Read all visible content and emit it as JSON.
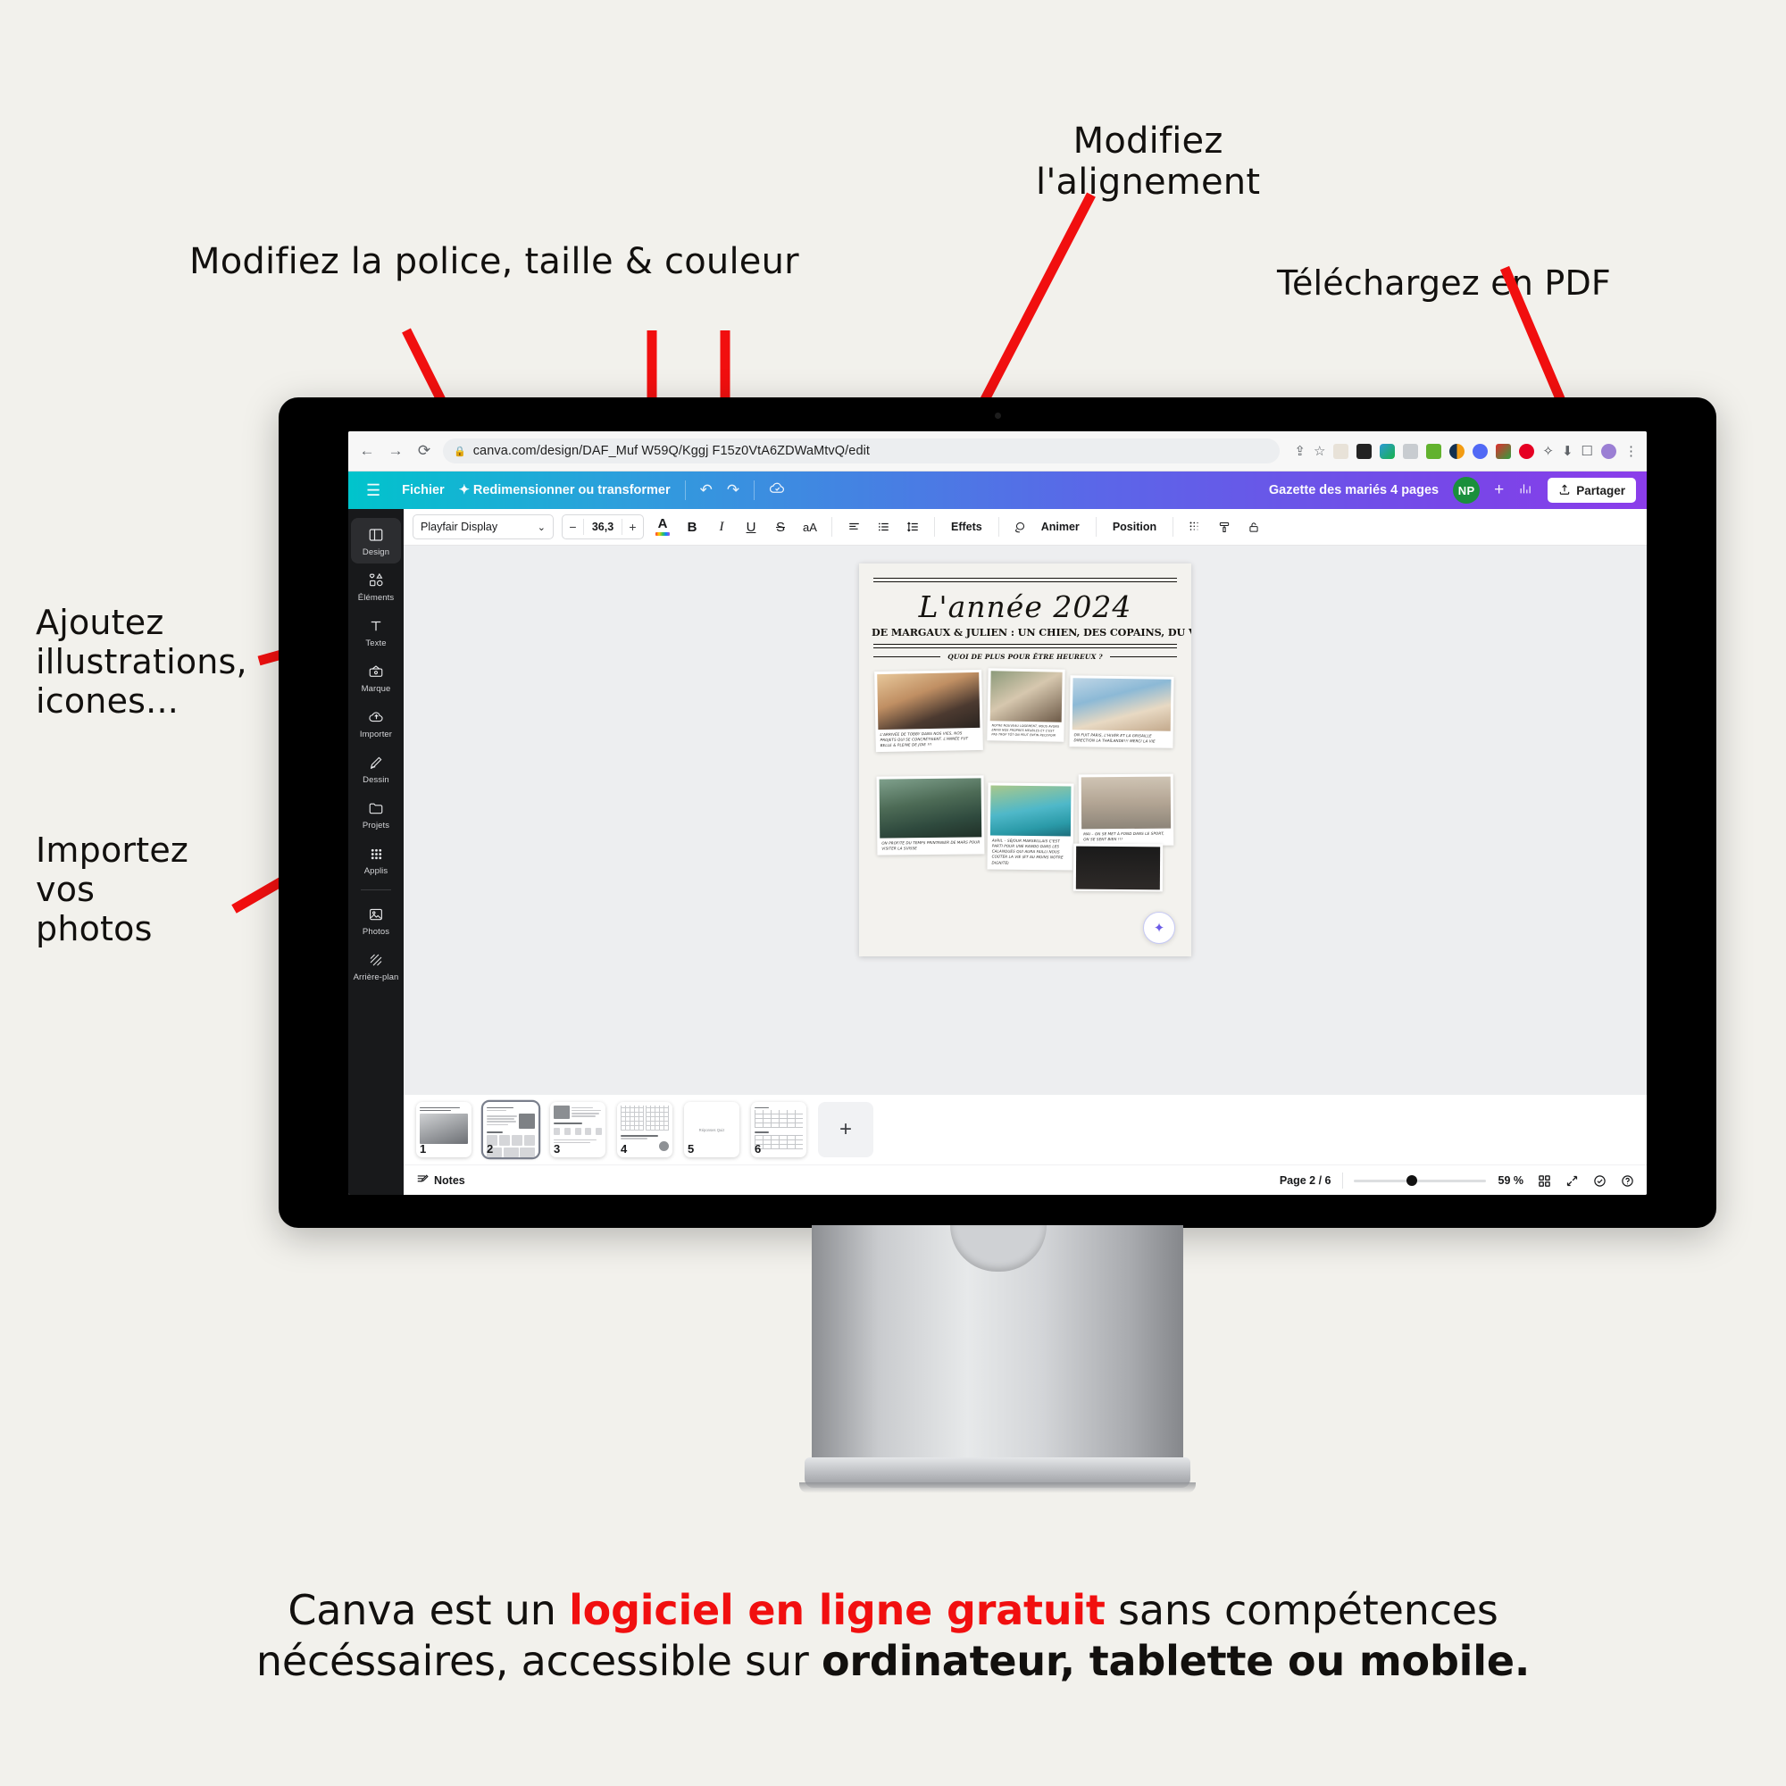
{
  "callouts": {
    "font": "Modifiez la police, taille & couleur",
    "align": "Modifiez\nl'alignement",
    "pdf": "Téléchargez en PDF",
    "elements": "Ajoutez\nillustrations,\nicones...",
    "upload": "Importez\nvos\nphotos"
  },
  "browser": {
    "back_icon": "←",
    "forward_icon": "→",
    "reload_icon": "⟳",
    "lock_icon": "🔒",
    "url": "canva.com/design/DAF_Muf W59Q/Kggj F15z0VtA6ZDWaMtvQ/edit",
    "share_icon": "share-icon",
    "bookmark_icon": "☆",
    "menu_icon": "⋮",
    "extensions": [
      "eyedropper",
      "fx",
      "translate",
      "screenshot",
      "grammar",
      "moon",
      "settings",
      "eco",
      "pinterest",
      "puzzle",
      "download",
      "sidepanel",
      "profile"
    ]
  },
  "canva_top": {
    "menu_icon": "☰",
    "file_label": "Fichier",
    "resize_label": "Redimensionner ou transformer",
    "resize_icon": "✦",
    "undo_icon": "↶",
    "redo_icon": "↷",
    "cloud_icon": "cloud-saved-icon",
    "design_title": "Gazette des mariés 4 pages",
    "avatar_initials": "NP",
    "add_member_icon": "+",
    "insights_icon": "insights-icon",
    "share_label": "Partager",
    "share_icon": "upload-icon"
  },
  "sidebar": {
    "items": [
      {
        "label": "Design",
        "icon": "layout-icon",
        "active": true
      },
      {
        "label": "Éléments",
        "icon": "shapes-icon",
        "active": false
      },
      {
        "label": "Texte",
        "icon": "text-icon",
        "active": false
      },
      {
        "label": "Marque",
        "icon": "brand-icon",
        "active": false
      },
      {
        "label": "Importer",
        "icon": "upload-cloud-icon",
        "active": false
      },
      {
        "label": "Dessin",
        "icon": "pencil-icon",
        "active": false
      },
      {
        "label": "Projets",
        "icon": "folder-icon",
        "active": false
      },
      {
        "label": "Applis",
        "icon": "grid-apps-icon",
        "active": false
      },
      {
        "label": "Photos",
        "icon": "photo-icon",
        "active": false
      },
      {
        "label": "Arrière-plan",
        "icon": "hatch-icon",
        "active": false
      }
    ]
  },
  "toolbar": {
    "font_name": "Playfair Display",
    "font_caret": "⌄",
    "minus": "−",
    "font_size": "36,3",
    "plus": "+",
    "color_letter": "A",
    "bold": "B",
    "italic": "I",
    "underline": "U",
    "strike": "S",
    "case": "aA",
    "align_icon": "align-left-icon",
    "list_icon": "list-icon",
    "spacing_icon": "line-spacing-icon",
    "effects_label": "Effets",
    "animate_label": "Animer",
    "animate_icon": "animate-icon",
    "position_label": "Position",
    "transparency_icon": "transparency-icon",
    "copy_style_icon": "paint-roller-icon",
    "lock_icon": "lock-icon"
  },
  "document": {
    "masthead": "L'année 2024",
    "subhead": "DE MARGAUX & JULIEN : UN CHIEN, DES COPAINS, DU VIN",
    "kicker": "QUOI DE PLUS POUR ÊTRE HEUREUX ?",
    "captions": [
      "L'ARRIVÉE DE TOBBY DANS NOS VIES, NOS PROJETS QUI SE CONCRÉTISENT. L'ANNÉE FUT BELLE & PLEINE DE JOIE !!!",
      "NOTRE NOUVEAU LOGEMENT, NOUS AVONS ENFIN NOS PROPRES MEUBLES ET C'EST PAS TROP TÔT ON PEUT ENFIN RECEVOIR",
      "ON FUIT PARIS, L'HIVER ET LA GRISAILLE DIRECTION LA THAÏLANDE!!! MERCI LA VIE",
      "ON PROFITE DU TEMPS PRINTANIER DE MARS POUR VISITER LA SUISSE",
      "AVRIL – SÉJOUR MARSEILLAIS C'EST PARTI POUR UNE RANDO DANS LES CALANQUES QUI AURA FAILLI NOUS COÛTER LA VIE (ET AU MOINS NOTRE DIGNITÉ)",
      "MAI – ON SE MET À FOND DANS LE SPORT, ON SE SENT BIEN !!!"
    ],
    "rotate_icon": "rotate-icon",
    "magic_icon": "magic-assistant-icon"
  },
  "pages_strip": {
    "numbers": [
      "1",
      "2",
      "3",
      "4",
      "5",
      "6"
    ],
    "selected": "2",
    "add_label": "+",
    "page5_text": "Réponses Quiz"
  },
  "statusbar": {
    "notes_label": "Notes",
    "notes_icon": "notes-icon",
    "page_indicator": "Page 2 / 6",
    "zoom_value": "59 %",
    "grid_icon": "grid-view-icon",
    "fullscreen_icon": "fullscreen-icon",
    "check_icon": "check-circle-icon",
    "help_icon": "help-icon"
  },
  "footer": {
    "part1": "Canva est un ",
    "highlight1": "logiciel en ligne gratuit",
    "part2": " sans compétences",
    "part3": "nécéssaires, accessible sur ",
    "highlight2": "ordinateur, tablette ou mobile."
  },
  "colors": {
    "accent_red": "#f10f0f",
    "canva_gradient_start": "#00c4cc",
    "canva_gradient_end": "#8b3dea",
    "avatar_green": "#1a8f3c",
    "background": "#f2f1ec"
  }
}
